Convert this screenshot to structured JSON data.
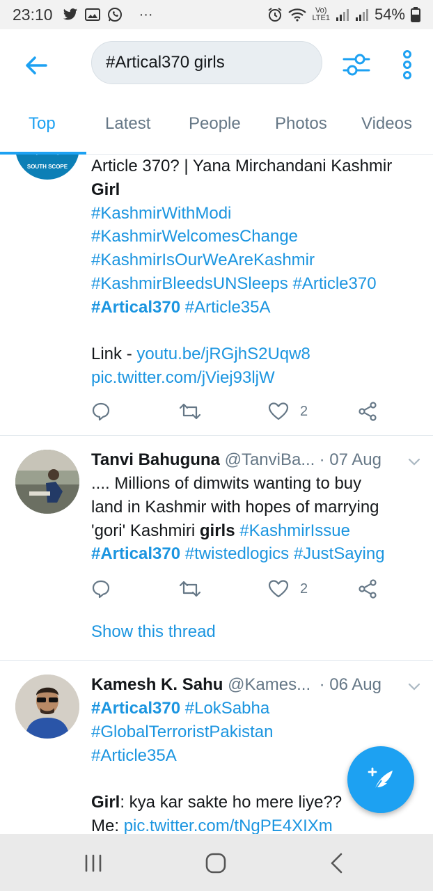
{
  "status_bar": {
    "time": "23:10",
    "ellipsis": "···",
    "lte_top": "Vo)",
    "lte_bottom": "LTE1",
    "battery": "54%"
  },
  "search": {
    "query": "#Artical370 girls"
  },
  "tabs": [
    {
      "label": "Top",
      "active": true
    },
    {
      "label": "Latest",
      "active": false
    },
    {
      "label": "People",
      "active": false
    },
    {
      "label": "Photos",
      "active": false
    },
    {
      "label": "Videos",
      "active": false
    }
  ],
  "tweets": [
    {
      "avatar_text": "SOUTH SCOPE",
      "line1": "Article 370? | Yana Mirchandani Kashmir",
      "line2": "Girl",
      "tags": [
        "#KashmirWithModi",
        "#KashmirWelcomesChange",
        "#KashmirIsOurWeAreKashmir"
      ],
      "tags_line4a": "#KashmirBleedsUNSleeps",
      "tags_line4b": "#Article370",
      "tag_bold": "#Artical370",
      "tag_after_bold": "#Article35A",
      "link_label": "Link - ",
      "link": "youtu.be/jRGjhS2Uqw8",
      "pic_link": "pic.twitter.com/jViej93ljW",
      "like_count": "2"
    },
    {
      "name": "Tanvi Bahuguna",
      "handle": "@TanviBa...",
      "date": "· 07 Aug",
      "text_line1": ".... Millions of dimwits wanting to buy",
      "text_line2": "land in Kashmir with hopes of marrying",
      "text_line3_pre": "'gori' Kashmiri ",
      "text_line3_bold": "girls",
      "text_line3_tag": "#KashmirIssue",
      "tag_bold": "#Artical370",
      "tags_rest": "#twistedlogics #JustSaying",
      "like_count": "2",
      "show_thread": "Show this thread"
    },
    {
      "name": "Kamesh K. Sahu",
      "handle": "@Kames...",
      "date": "· 06 Aug",
      "tag_bold": "#Artical370",
      "tag_after_bold": "#LokSabha",
      "tags": [
        "#GlobalTerroristPakistan",
        "#Article35A"
      ],
      "text_bold": "Girl",
      "text_rest": ": kya kar sakte ho mere liye??",
      "me_label": "Me: ",
      "pic_link": "pic.twitter.com/tNgPE4XIXm"
    }
  ],
  "icons": {
    "back": "arrow-left",
    "filter": "sliders",
    "more": "vertical-ellipsis",
    "reply": "speech-bubble",
    "retweet": "retweet",
    "like": "heart",
    "share": "share",
    "compose": "feather-plus"
  },
  "colors": {
    "accent": "#1da1f2",
    "link": "#1b95e0",
    "muted": "#657786"
  }
}
